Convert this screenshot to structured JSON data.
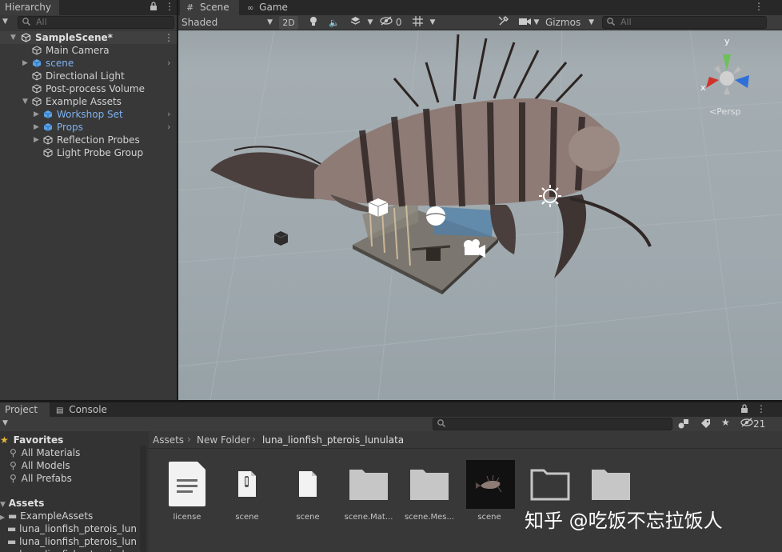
{
  "hierarchy": {
    "tab": "Hierarchy",
    "search_placeholder": "All",
    "scene_name": "SampleScene*",
    "items": [
      {
        "label": "Main Camera"
      },
      {
        "label": "scene"
      },
      {
        "label": "Directional Light"
      },
      {
        "label": "Post-process Volume"
      },
      {
        "label": "Example Assets"
      },
      {
        "label": "Workshop Set"
      },
      {
        "label": "Props"
      },
      {
        "label": "Reflection Probes"
      },
      {
        "label": "Light Probe Group"
      }
    ]
  },
  "scene": {
    "tabs": [
      "Scene",
      "Game"
    ],
    "shading": "Shaded",
    "mode_2d": "2D",
    "hidden_count": "0",
    "gizmos": "Gizmos",
    "search_placeholder": "All",
    "persp_label": "Persp",
    "axis_y": "y",
    "axis_x": "x"
  },
  "project": {
    "tabs": [
      "Project",
      "Console"
    ],
    "hidden_count": "21",
    "favorites": {
      "title": "Favorites",
      "items": [
        "All Materials",
        "All Models",
        "All Prefabs"
      ]
    },
    "assets": {
      "title": "Assets",
      "items": [
        "ExampleAssets",
        "luna_lionfish_pterois_lunul",
        "luna_lionfish_pterois_lunul",
        "luna_lionfish_pterois_lunul"
      ]
    },
    "breadcrumb": [
      "Assets",
      "New Folder",
      "luna_lionfish_pterois_lunulata"
    ],
    "files": [
      {
        "name": "license",
        "icon": "text-file-icon"
      },
      {
        "name": "scene",
        "icon": "binary-file-icon"
      },
      {
        "name": "scene",
        "icon": "blank-file-icon"
      },
      {
        "name": "scene.Mat...",
        "icon": "folder-icon"
      },
      {
        "name": "scene.Mes...",
        "icon": "folder-icon"
      },
      {
        "name": "scene",
        "icon": "model-preview-icon"
      },
      {
        "name": "",
        "icon": "empty-folder-icon"
      },
      {
        "name": "",
        "icon": "folder-icon"
      }
    ]
  },
  "watermark": "知乎 @吃饭不忘拉饭人",
  "colors": {
    "accent_blue": "#7fb2f0",
    "panel_bg": "#383838",
    "toolbar_bg": "#282828"
  }
}
